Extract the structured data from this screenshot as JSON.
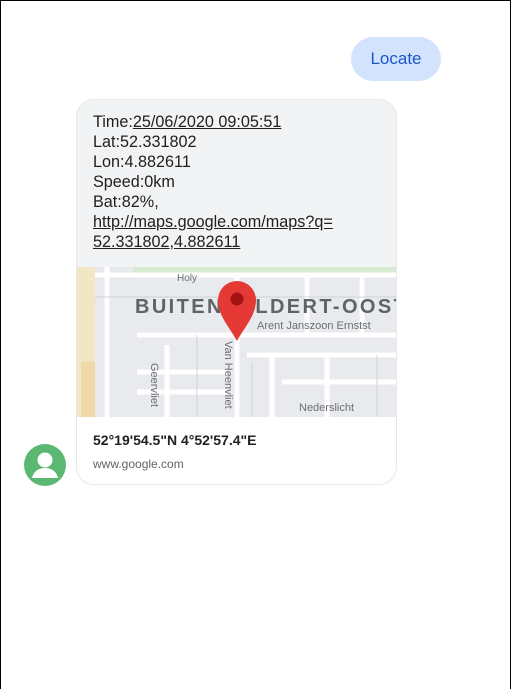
{
  "conversation": {
    "sent_message": "Locate",
    "received": {
      "time_label": "Time:",
      "time_value": "25/06/2020 09:05:51",
      "lat": "Lat:52.331802",
      "lon": "Lon:4.882611",
      "speed": "Speed:0km",
      "battery": "Bat:82%,",
      "link_line1": "http://maps.google.com/maps?q=",
      "link_line2": "52.331802,4.882611"
    },
    "map": {
      "district_label": "BUITENVELDERT-OOST",
      "street_top": "Holy",
      "street_right": "Arent Janszoon Ernstst",
      "street_vertical": "Van Heenvliet",
      "street_left": "Geervliet",
      "street_bottom": "Nederslicht",
      "pin_color": "#e53935"
    },
    "preview": {
      "title": "52°19'54.5\"N 4°52'57.4\"E",
      "domain": "www.google.com"
    },
    "avatar": {
      "icon": "person-icon",
      "color": "#5bb872"
    }
  }
}
